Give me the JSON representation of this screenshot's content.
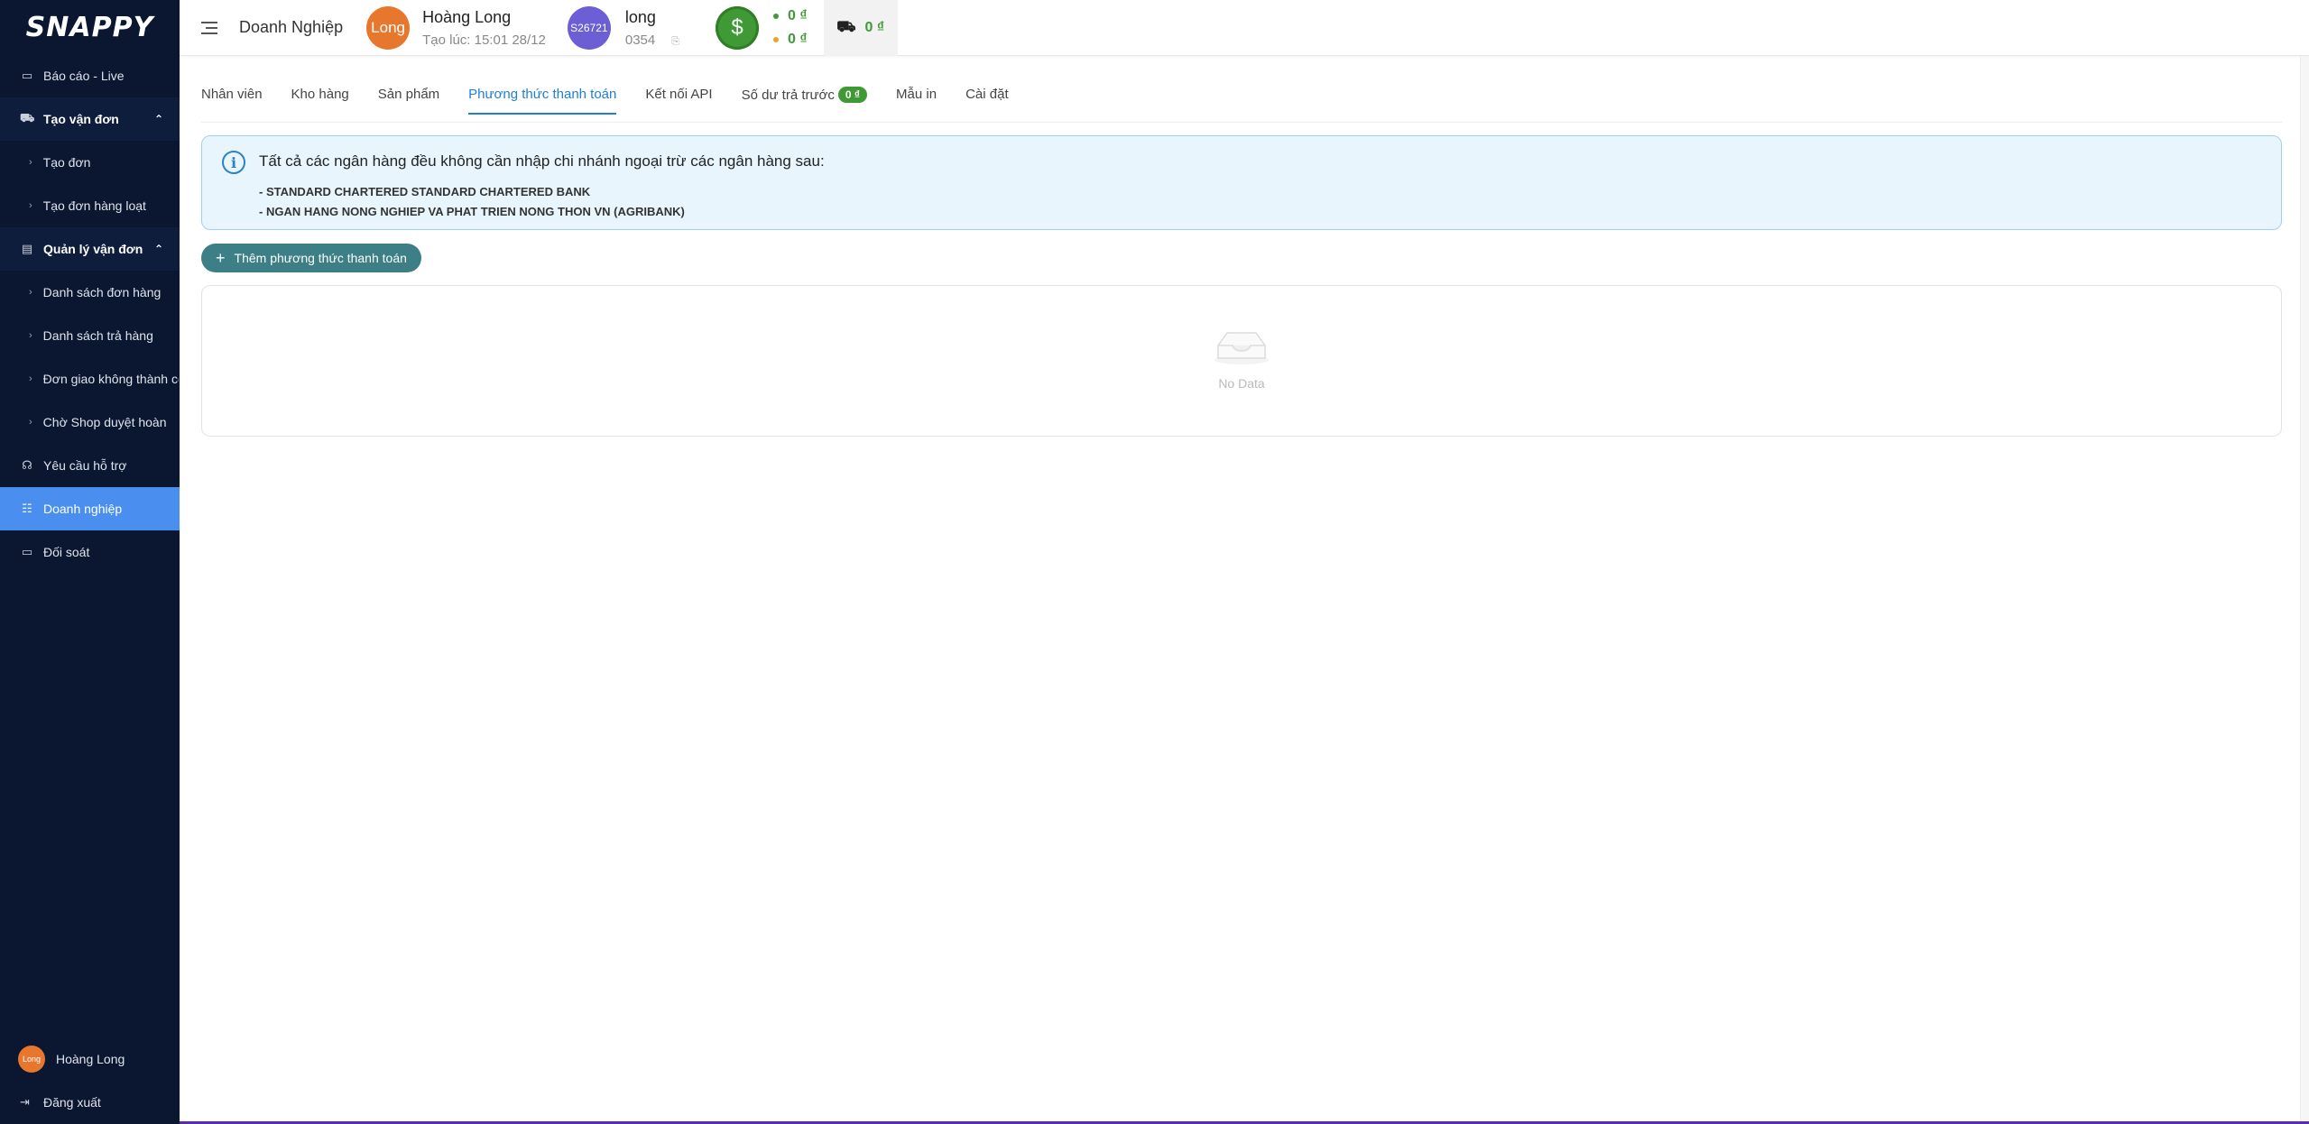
{
  "brand": {
    "logo": "SNAPPY"
  },
  "sidebar": {
    "items": [
      {
        "label": "Báo cáo - Live",
        "icon": "monitor-icon",
        "glyph": "▭"
      },
      {
        "label": "Tạo vận đơn",
        "icon": "cart-icon",
        "glyph": "⛟"
      },
      {
        "label": "Tạo đơn"
      },
      {
        "label": "Tạo đơn hàng loạt"
      },
      {
        "label": "Quản lý vận đơn",
        "icon": "document-icon",
        "glyph": "▤"
      },
      {
        "label": "Danh sách đơn hàng"
      },
      {
        "label": "Danh sách trả hàng"
      },
      {
        "label": "Đơn giao không thành công"
      },
      {
        "label": "Chờ Shop duyệt hoàn"
      },
      {
        "label": "Yêu cầu hỗ trợ",
        "icon": "headset-icon",
        "glyph": "☊"
      },
      {
        "label": "Doanh nghiệp",
        "icon": "team-icon",
        "glyph": "☷"
      },
      {
        "label": "Đối soát",
        "icon": "card-icon",
        "glyph": "▭"
      }
    ],
    "footer": {
      "avatar_text": "Long",
      "user_name": "Hoàng Long",
      "logout_label": "Đăng xuất"
    }
  },
  "header": {
    "page_title": "Doanh Nghiệp",
    "user_avatar_text": "Long",
    "user_name": "Hoàng Long",
    "created_at": "Tạo lúc: 15:01 28/12",
    "shop_avatar_text": "S26721",
    "shop_name": "long",
    "shop_phone": "0354",
    "balance_1": "0 ₫",
    "balance_2": "0 ₫",
    "shipping_balance": "0 ₫",
    "colors": {
      "green": "#3f9a35",
      "orange": "#e8772e",
      "purple": "#6c5fd6"
    }
  },
  "tabs": [
    {
      "label": "Nhân viên"
    },
    {
      "label": "Kho hàng"
    },
    {
      "label": "Sản phẩm"
    },
    {
      "label": "Phương thức thanh toán",
      "active": true
    },
    {
      "label": "Kết nối API"
    },
    {
      "label": "Số dư trả trước",
      "badge": "0 ₫"
    },
    {
      "label": "Mẫu in"
    },
    {
      "label": "Cài đặt"
    }
  ],
  "info": {
    "title": "Tất cả các ngân hàng đều không cần nhập chi nhánh ngoại trừ các ngân hàng sau:",
    "lines": [
      "- STANDARD CHARTERED STANDARD CHARTERED BANK",
      "- NGAN HANG NONG NGHIEP VA PHAT TRIEN NONG THON VN (AGRIBANK)"
    ]
  },
  "actions": {
    "add_payment_label": "Thêm phương thức thanh toán"
  },
  "empty": {
    "text": "No Data"
  }
}
